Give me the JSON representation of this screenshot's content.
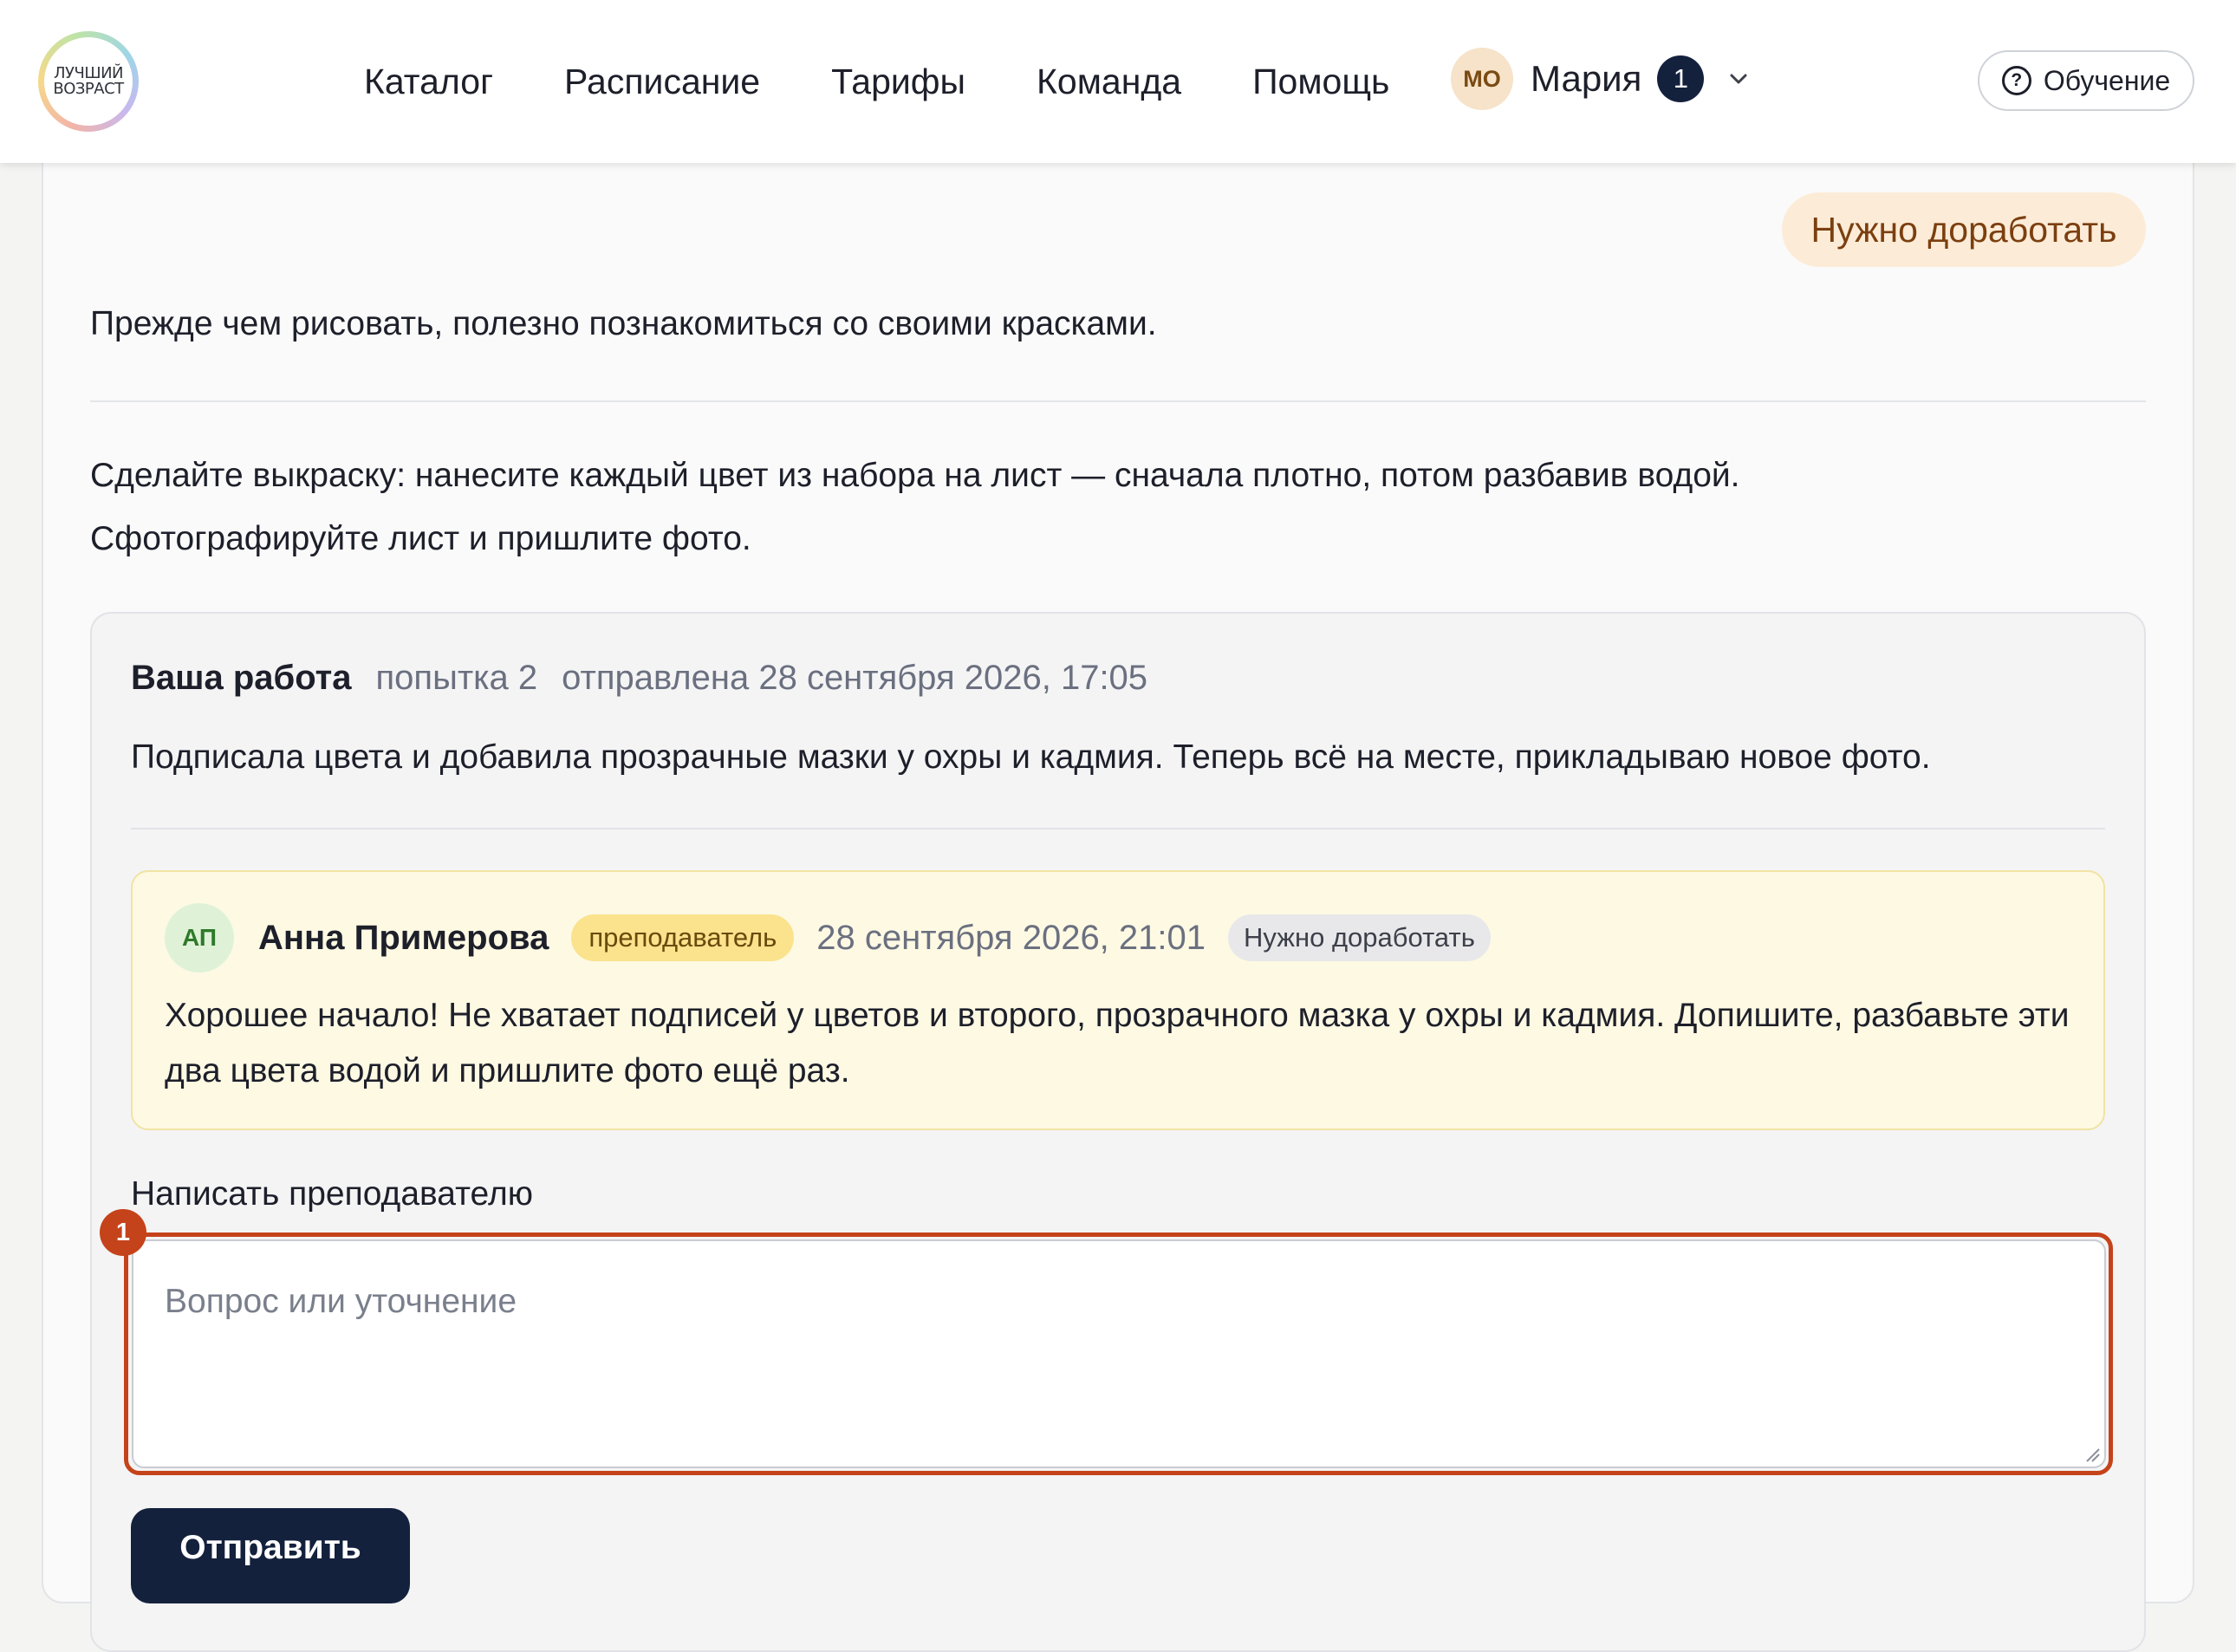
{
  "header": {
    "logo_line1": "ЛУЧШИЙ",
    "logo_line2": "ВОЗРАСТ",
    "nav": [
      "Каталог",
      "Расписание",
      "Тарифы",
      "Команда",
      "Помощь"
    ],
    "user": {
      "initials": "МО",
      "name": "Мария",
      "notifications": "1"
    },
    "learn_button": "Обучение"
  },
  "lesson": {
    "status": "Нужно доработать",
    "intro": "Прежде чем рисовать, полезно познакомиться со своими красками.",
    "task_line1": "Сделайте выкраску: нанесите каждый цвет из набора на лист — сначала плотно, потом разбавив водой.",
    "task_line2": "Сфотографируйте лист и пришлите фото."
  },
  "submission": {
    "title": "Ваша работа",
    "attempt": "попытка 2",
    "sent": "отправлена 28 сентября 2026, 17:05",
    "text": "Подписала цвета и добавила прозрачные мазки у охры и кадмия. Теперь всё на месте, прикладываю новое фото."
  },
  "feedback": {
    "initials": "АП",
    "author": "Анна Примерова",
    "role": "преподаватель",
    "date": "28 сентября 2026, 21:01",
    "status": "Нужно доработать",
    "text": "Хорошее начало! Не хватает подписей у цветов и второго, прозрачного мазка у охры и кадмия. Допишите, разбавьте эти два цвета водой и пришлите фото ещё раз."
  },
  "message_form": {
    "label": "Написать преподавателю",
    "placeholder": "Вопрос или уточнение",
    "value": "",
    "marker": "1",
    "send_button": "Отправить"
  },
  "colors": {
    "accent_dark": "#14213d",
    "status_bg": "#fcecd7",
    "status_text": "#7c3f10",
    "highlight": "#c5431a",
    "comment_bg": "#fdf9e3",
    "role_badge_bg": "#fbe28c"
  },
  "icons": {
    "chevron": "chevron-down-icon",
    "help": "question-circle-icon",
    "resize": "resize-grip-icon"
  }
}
